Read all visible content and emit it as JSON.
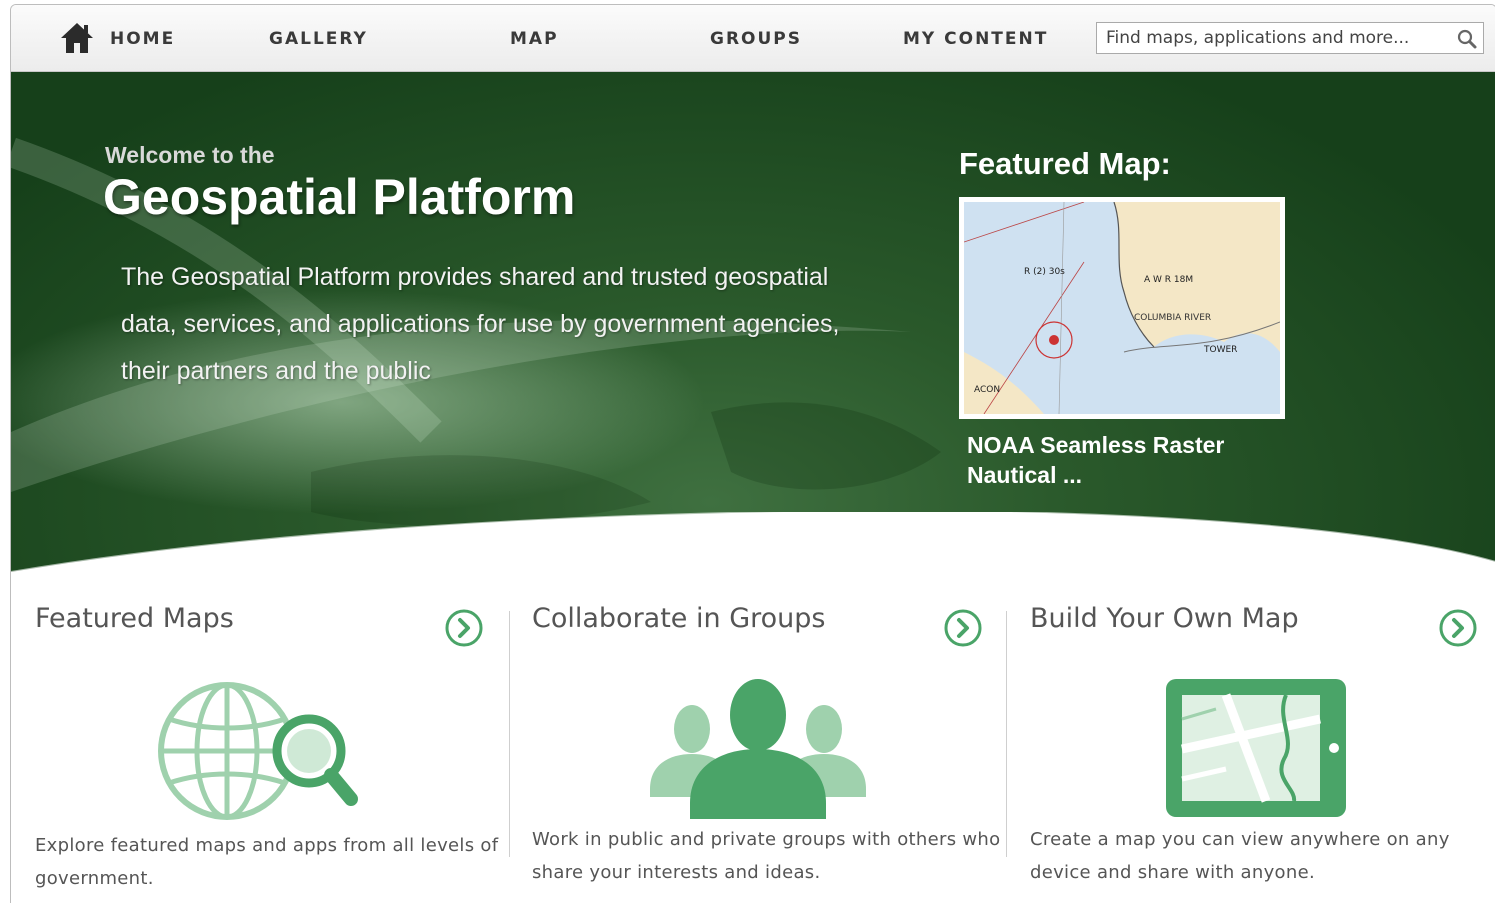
{
  "nav": {
    "home_label": "HOME",
    "items": [
      "GALLERY",
      "MAP",
      "GROUPS",
      "MY CONTENT"
    ],
    "search_placeholder": "Find maps, applications and more..."
  },
  "hero": {
    "welcome": "Welcome to the",
    "title": "Geospatial Platform",
    "description": "The Geospatial Platform provides shared and trusted geospatial data, services, and applications for use by government agencies, their partners and the public",
    "featured_heading": "Featured Map:",
    "featured_caption": "NOAA Seamless Raster Nautical ..."
  },
  "panels": [
    {
      "title": "Featured Maps",
      "text": "Explore featured maps and apps from all levels of government.",
      "icon": "globe-magnifier-icon"
    },
    {
      "title": "Collaborate in Groups",
      "text": "Work in public and private groups with others who share your interests and ideas.",
      "icon": "people-group-icon"
    },
    {
      "title": "Build Your Own Map",
      "text": "Create a map you can view anywhere on any device and share with anyone.",
      "icon": "tablet-map-icon"
    }
  ],
  "colors": {
    "brand_green": "#2a592b",
    "accent_green": "#4aa468",
    "light_green": "#9fd1ad"
  }
}
